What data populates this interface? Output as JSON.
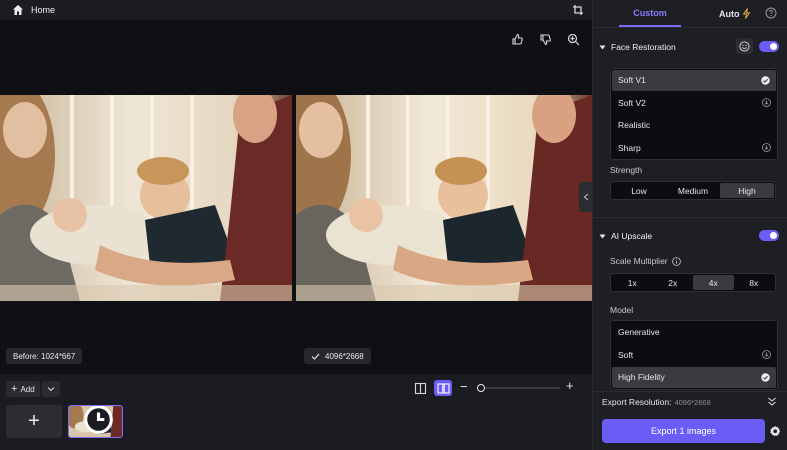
{
  "topbar": {
    "home_label": "Home"
  },
  "canvas": {
    "before_badge": "Before: 1024*667",
    "after_badge": "4096*2668"
  },
  "bottom": {
    "add_label": "Add",
    "add_tile_glyph": "+",
    "zoom_minus": "−",
    "zoom_plus": "+",
    "zoom_level": 0
  },
  "panel": {
    "tabs": {
      "custom": "Custom",
      "auto": "Auto"
    },
    "face_restoration": {
      "title": "Face Restoration",
      "enabled": true,
      "models": [
        {
          "label": "Soft V1",
          "state": "selected"
        },
        {
          "label": "Soft V2",
          "state": "download"
        },
        {
          "label": "Realistic",
          "state": "none"
        },
        {
          "label": "Sharp",
          "state": "download"
        }
      ],
      "strength_label": "Strength",
      "strength_options": [
        "Low",
        "Medium",
        "High"
      ],
      "strength_selected": "High"
    },
    "ai_upscale": {
      "title": "AI Upscale",
      "enabled": true,
      "scale_label": "Scale Multiplier",
      "scale_options": [
        "1x",
        "2x",
        "4x",
        "8x"
      ],
      "scale_selected": "4x",
      "model_label": "Model",
      "models": [
        {
          "label": "Generative",
          "state": "none"
        },
        {
          "label": "Soft",
          "state": "download"
        },
        {
          "label": "High Fidelity",
          "state": "selected"
        }
      ]
    },
    "export": {
      "resolution_label": "Export Resolution:",
      "resolution_value": "4096*2668",
      "button_label": "Export 1 images"
    }
  },
  "colors": {
    "accent": "#6b5cf6",
    "accent_text": "#8b7bff",
    "panel_bg": "#1e1f24",
    "canvas_bg": "#0f1013"
  }
}
